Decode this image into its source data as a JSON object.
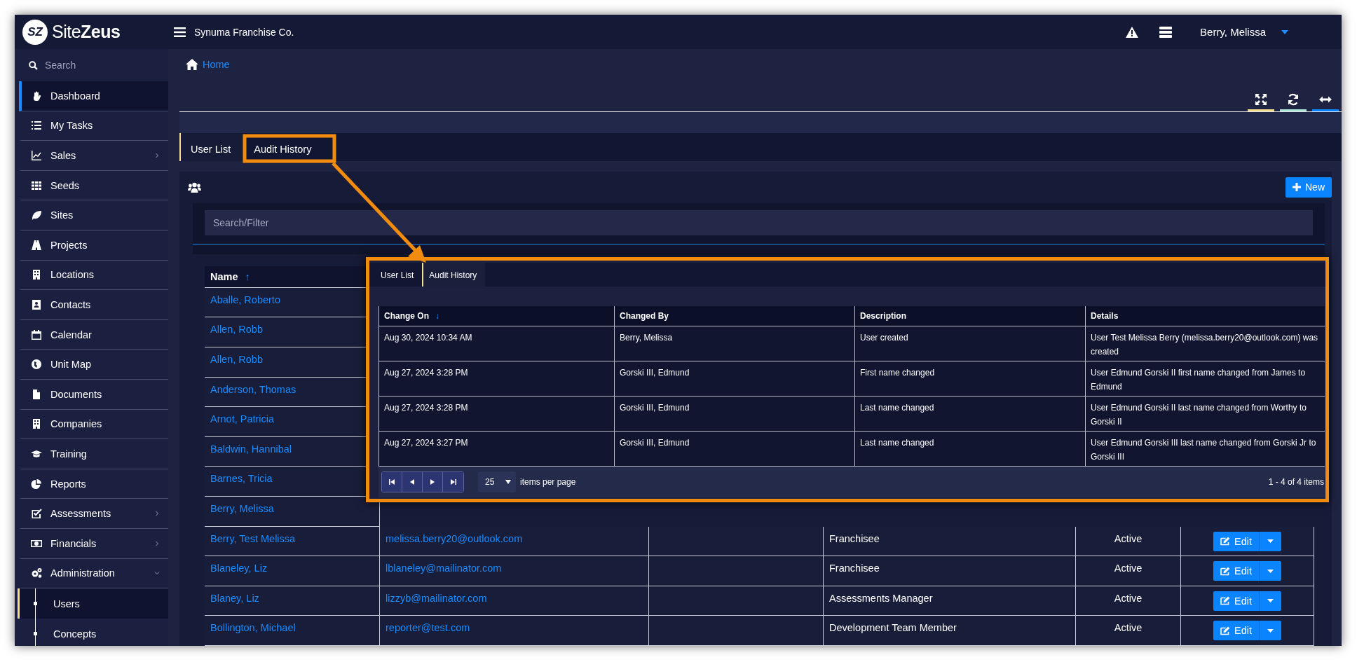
{
  "header": {
    "logo_mark": "SZ",
    "brand": "Site**Zeus**",
    "company": "Synuma Franchise Co.",
    "user": "Berry, Melissa"
  },
  "sidebar": {
    "search_placeholder": "Search",
    "items": [
      {
        "label": "Dashboard",
        "selected": true
      },
      {
        "label": "My Tasks",
        "selected": false
      },
      {
        "label": "Sales",
        "selected": false,
        "expanded": false
      },
      {
        "label": "Seeds",
        "selected": false
      },
      {
        "label": "Sites",
        "selected": false
      },
      {
        "label": "Projects",
        "selected": false
      },
      {
        "label": "Locations",
        "selected": false
      },
      {
        "label": "Contacts",
        "selected": false
      },
      {
        "label": "Calendar",
        "selected": false
      },
      {
        "label": "Unit Map",
        "selected": false
      },
      {
        "label": "Documents",
        "selected": false
      },
      {
        "label": "Companies",
        "selected": false
      },
      {
        "label": "Training",
        "selected": false
      },
      {
        "label": "Reports",
        "selected": false
      },
      {
        "label": "Assessments",
        "selected": false,
        "expanded": false
      },
      {
        "label": "Financials",
        "selected": false,
        "expanded": false
      },
      {
        "label": "Administration",
        "selected": false,
        "expanded": true,
        "children": [
          {
            "label": "Users",
            "selected": true
          },
          {
            "label": "Concepts",
            "selected": false
          }
        ]
      }
    ]
  },
  "breadcrumb": {
    "label": "Home"
  },
  "toolbar": [
    {
      "color": "#f3dd8c"
    },
    {
      "color": "#a9e5d2"
    },
    {
      "color": "#0a84ff"
    }
  ],
  "tabs": [
    {
      "label": "User List",
      "selected": true
    },
    {
      "label": "Audit History",
      "selected": false
    }
  ],
  "new_button": "New",
  "filter": {
    "placeholder": "Search/Filter"
  },
  "table": {
    "columns": [
      {
        "label": "Name",
        "sort_indicator": "↑"
      }
    ],
    "rows": [
      {
        "name": "Aballe, Roberto"
      },
      {
        "name": "Allen, Robb"
      },
      {
        "name": "Allen, Robb"
      },
      {
        "name": "Anderson, Thomas"
      },
      {
        "name": "Arnot, Patricia"
      },
      {
        "name": "Baldwin, Hannibal"
      },
      {
        "name": "Barnes, Tricia"
      },
      {
        "name": "Berry, Melissa"
      },
      {
        "name": "Berry, Test Melissa",
        "email": "melissa.berry20@outlook.com",
        "role": "Franchisee",
        "status": "Active",
        "action": "Edit"
      },
      {
        "name": "Blaneley, Liz",
        "email": "lblaneley@mailinator.com",
        "role": "Franchisee",
        "status": "Active",
        "action": "Edit"
      },
      {
        "name": "Blaney, Liz",
        "email": "lizzyb@mailinator.com",
        "role": "Assessments Manager",
        "status": "Active",
        "action": "Edit"
      },
      {
        "name": "Bollington, Michael",
        "email": "reporter@test.com",
        "role": "Development Team Member",
        "status": "Active",
        "action": "Edit"
      }
    ]
  },
  "inset": {
    "tabs": [
      {
        "label": "User List",
        "selected": false
      },
      {
        "label": "Audit History",
        "selected": true
      }
    ],
    "table": {
      "columns": [
        {
          "label": "Change On",
          "sort_indicator": "↓"
        },
        {
          "label": "Changed By"
        },
        {
          "label": "Description"
        },
        {
          "label": "Details"
        }
      ],
      "rows": [
        [
          "Aug 30, 2024 10:34 AM",
          "Berry, Melissa",
          "User created",
          "User Test Melissa Berry (melissa.berry20@outlook.com) was created"
        ],
        [
          "Aug 27, 2024 3:28 PM",
          "Gorski III, Edmund",
          "First name changed",
          "User Edmund Gorski II first name changed from James to Edmund"
        ],
        [
          "Aug 27, 2024 3:28 PM",
          "Gorski III, Edmund",
          "Last name changed",
          "User Edmund Gorski II last name changed from Worthy to Gorski II"
        ],
        [
          "Aug 27, 2024 3:27 PM",
          "Gorski III, Edmund",
          "Last name changed",
          "User Edmund Gorski III last name changed from Gorski Jr to Gorski III"
        ]
      ]
    },
    "pager": {
      "page_size": "25",
      "page_size_label": "items per page",
      "summary": "1 - 4 of 4 items"
    }
  }
}
